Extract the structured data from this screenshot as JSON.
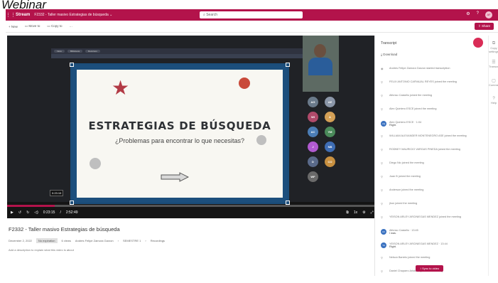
{
  "caption": "Webinar",
  "topbar": {
    "app_name": "Stream",
    "doc_name": "F2332 - Taller masivo Estrategias de búsqueda",
    "search_placeholder": "Search",
    "settings_icon": "gear-icon",
    "help_icon": "help-icon",
    "user_initials": "AF"
  },
  "cmdbar": {
    "new_label": "+ New",
    "move_label": "Move to",
    "copy_label": "Copy to",
    "more_label": "···",
    "share_label": "Share"
  },
  "slide": {
    "title": "ESTRATEGIAS DE BÚSQUEDA",
    "subtitle": "¿Problemas para encontrar lo que necesitas?"
  },
  "browser_tabs": [
    "Inicio",
    "Biblioteca",
    "Recursos"
  ],
  "participants": [
    {
      "initials": "AG",
      "color": "#6a7a8a"
    },
    {
      "initials": "AE",
      "color": "#8b96a8"
    },
    {
      "initials": "WI",
      "color": "#b04a6a"
    },
    {
      "initials": "A",
      "color": "#d4a056"
    },
    {
      "initials": "AC",
      "color": "#4b7db5"
    },
    {
      "initials": "YM",
      "color": "#4a8a5a"
    },
    {
      "initials": "J",
      "color": "#b05ad0"
    },
    {
      "initials": "NB",
      "color": "#3e6db4"
    },
    {
      "initials": "D",
      "color": "#5a6a8a"
    },
    {
      "initials": "CO",
      "color": "#c89040"
    },
    {
      "initials": "WF",
      "color": "#6a6a6a"
    }
  ],
  "player": {
    "hover_time": "0:23:15",
    "current_time": "0:23:15",
    "duration": "2:52:49",
    "progress_fraction": 0.13,
    "speed": "1x"
  },
  "video": {
    "title": "F2332 - Taller masivo Estrategias de búsqueda",
    "date": "December 2, 2022",
    "expiry": "No expiration",
    "views": "6 views",
    "author": "Andres Felipe Zamora Garzon",
    "path": "SEMESTRE 1",
    "folder": "Recordings",
    "description_placeholder": "Add a description to explain what this video is about"
  },
  "transcript": {
    "title": "Transcript",
    "download_label": "Download",
    "sync_label": "Sync to video",
    "entries": [
      {
        "type": "system",
        "text": "Andres Felipe Zamora Garzon started transcription"
      },
      {
        "type": "join",
        "text": "FELIX ANTONIO CARVAJAL REYES joined the meeting"
      },
      {
        "type": "join",
        "text": "Alfonso Castaño joined the meeting"
      },
      {
        "type": "join",
        "text": "Alex Quintero ESCE joined the meeting"
      },
      {
        "type": "speech",
        "initials": "AQ",
        "speaker": "Alex Quintero ESCE · 1:04",
        "text": "Right."
      },
      {
        "type": "join",
        "text": "WILLIAM ALEXANDER MONTENEGRO ASE joined the meeting"
      },
      {
        "type": "join",
        "text": "RODNEY MAURICIO VARGAS PINEDA joined the meeting"
      },
      {
        "type": "join",
        "text": "Diego Nio joined the meeting"
      },
      {
        "type": "join",
        "text": "Juan B joined the meeting"
      },
      {
        "type": "join",
        "text": "Anderson joined the meeting"
      },
      {
        "type": "join",
        "text": "jhon joined the meeting"
      },
      {
        "type": "join",
        "text": "YEISON ARLEY ARCINIEGAS MENDEZ joined the meeting"
      },
      {
        "type": "speech",
        "initials": "AC",
        "speaker": "Alfonso Castaño · 13:45",
        "text": "I was."
      },
      {
        "type": "speech",
        "initials": "YA",
        "speaker": "YEISON ARLEY ARCINIEGAS MENDEZ · 13:44",
        "text": "Right."
      },
      {
        "type": "join",
        "text": "Nelson Barreto joined the meeting"
      },
      {
        "type": "join",
        "text": "Daniel Chaparro Aristobal joined the meeting"
      }
    ]
  },
  "rail": [
    {
      "icon": "copy-settings-icon",
      "label": "Copy settings"
    },
    {
      "icon": "transcript-icon",
      "label": "Transcript"
    },
    {
      "icon": "comments-icon",
      "label": "Comments"
    },
    {
      "icon": "help-icon",
      "label": "Help"
    }
  ]
}
